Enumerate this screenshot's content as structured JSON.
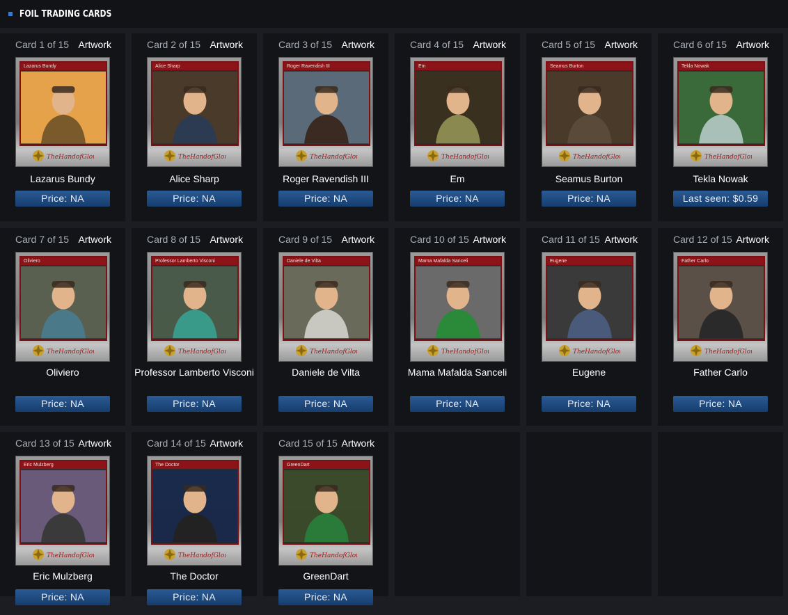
{
  "header": {
    "title": "FOIL TRADING CARDS"
  },
  "artwork_label": "Artwork",
  "cards": [
    {
      "num": "Card 1 of 15",
      "name": "Lazarus Bundy",
      "bar": "Lazarus Bundy",
      "price": "Price: NA"
    },
    {
      "num": "Card 2 of 15",
      "name": "Alice Sharp",
      "bar": "Alice Sharp",
      "price": "Price: NA"
    },
    {
      "num": "Card 3 of 15",
      "name": "Roger Ravendish III",
      "bar": "Roger Ravendish III",
      "price": "Price: NA"
    },
    {
      "num": "Card 4 of 15",
      "name": "Em",
      "bar": "Em",
      "price": "Price: NA"
    },
    {
      "num": "Card 5 of 15",
      "name": "Seamus Burton",
      "bar": "Seamus Burton",
      "price": "Price: NA"
    },
    {
      "num": "Card 6 of 15",
      "name": "Tekla Nowak",
      "bar": "Tekla Nowak",
      "price": "Last seen: $0.59"
    },
    {
      "num": "Card 7 of 15",
      "name": "Oliviero",
      "bar": "Oliviero",
      "price": "Price: NA"
    },
    {
      "num": "Card 8 of 15",
      "name": "Professor Lamberto Visconi",
      "bar": "Professor Lamberto Visconi",
      "price": "Price: NA"
    },
    {
      "num": "Card 9 of 15",
      "name": "Daniele de Vilta",
      "bar": "Daniele de Vilta",
      "price": "Price: NA"
    },
    {
      "num": "Card 10 of 15",
      "name": "Mama Mafalda Sanceli",
      "bar": "Mama Mafalda Sanceli",
      "price": "Price: NA"
    },
    {
      "num": "Card 11 of 15",
      "name": "Eugene",
      "bar": "Eugene",
      "price": "Price: NA"
    },
    {
      "num": "Card 12 of 15",
      "name": "Father Carlo",
      "bar": "Father Carlo",
      "price": "Price: NA"
    },
    {
      "num": "Card 13 of 15",
      "name": "Eric Mulzberg",
      "bar": "Eric Mulzberg",
      "price": "Price: NA"
    },
    {
      "num": "Card 14 of 15",
      "name": "The Doctor",
      "bar": "The Doctor",
      "price": "Price: NA"
    },
    {
      "num": "Card 15 of 15",
      "name": "GreenDart",
      "bar": "GreenDart",
      "price": "Price: NA"
    }
  ],
  "colors": {
    "accent": "#2f7dd6",
    "price_button": "#1d4a80",
    "card_frame_red": "#8c1318"
  }
}
